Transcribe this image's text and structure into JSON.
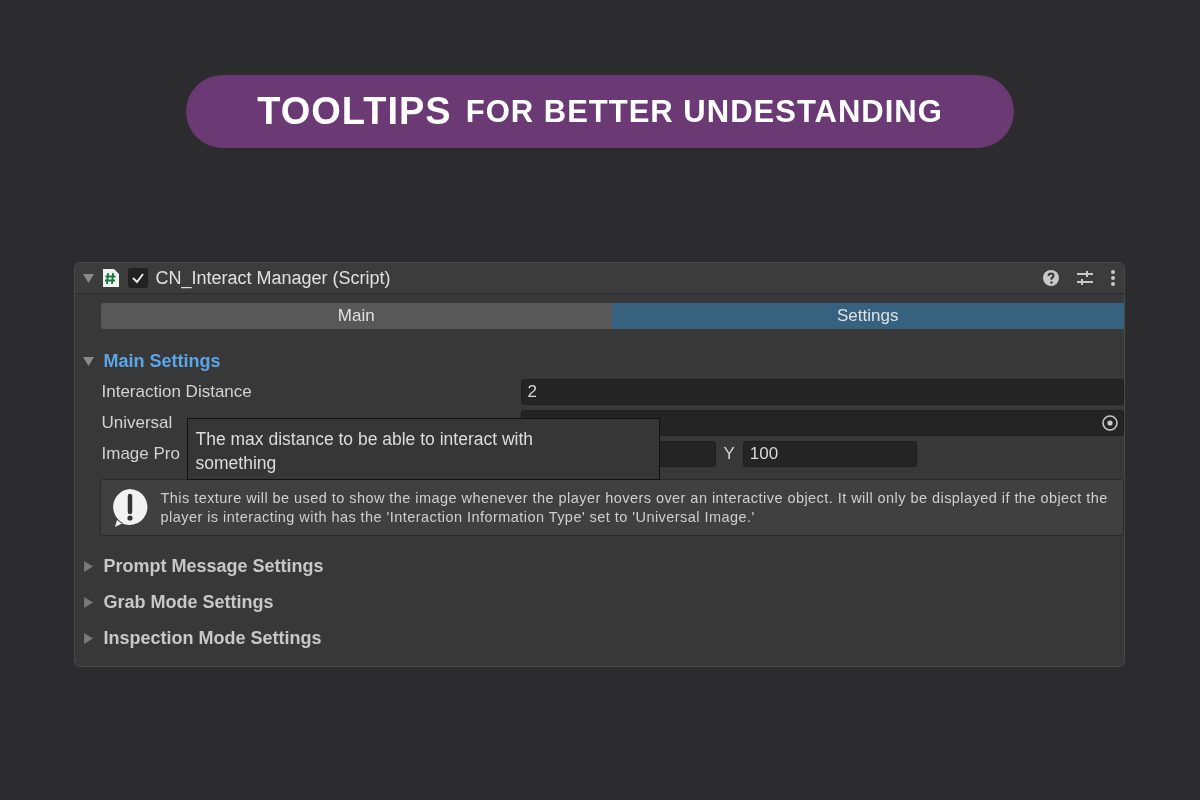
{
  "banner": {
    "title_bold": "TOOLTIPS",
    "title_rest": "FOR BETTER UNDESTANDING"
  },
  "component": {
    "title": "CN_Interact Manager (Script)",
    "enabled": true,
    "expanded": true
  },
  "tabs": [
    {
      "label": "Main",
      "selected": false
    },
    {
      "label": "Settings",
      "selected": true
    }
  ],
  "sections": [
    {
      "title": "Main Settings",
      "expanded": true,
      "fields": [
        {
          "kind": "number",
          "label": "Interaction Distance",
          "value": "2"
        },
        {
          "kind": "object",
          "label": "Universal"
        },
        {
          "kind": "vector2",
          "label": "Image Pro",
          "y_label": "Y",
          "y_value": "100"
        }
      ],
      "help": "This texture will be used to show the image whenever the player hovers over an interactive object. It will only be displayed if the object the player is interacting with has the 'Interaction Information Type' set to 'Universal Image.'"
    },
    {
      "title": "Prompt Message Settings",
      "expanded": false
    },
    {
      "title": "Grab Mode Settings",
      "expanded": false
    },
    {
      "title": "Inspection Mode Settings",
      "expanded": false
    }
  ],
  "tooltip": {
    "text": "The max distance to be able to interact with something"
  }
}
